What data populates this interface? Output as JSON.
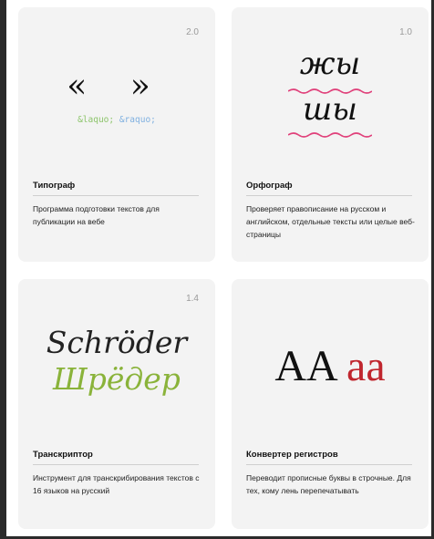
{
  "cards": [
    {
      "version": "2.0",
      "title": "Типограф",
      "description": "Программа подготовки текстов для публикации на вебе",
      "illustration": {
        "quotes": "« »",
        "entity_open": "&laquo;",
        "entity_close": "&raquo;"
      }
    },
    {
      "version": "1.0",
      "title": "Орфограф",
      "description": "Проверяет правописание на русском и английском, отдельные тексты или целые веб-страницы",
      "illustration": {
        "word1": "жы",
        "word2": "шы",
        "underline_color": "#e0407a"
      }
    },
    {
      "version": "1.4",
      "title": "Транскриптор",
      "description": "Инструмент для транскрибирования текстов с 16 языков на русский",
      "illustration": {
        "source": "Schröder",
        "target": "Шрёдер",
        "target_color": "#8ab33a"
      }
    },
    {
      "version": "",
      "title": "Конвертер регистров",
      "description": "Переводит прописные буквы в строчные. Для тех, кому лень перепечатывать",
      "illustration": {
        "upper": "AA",
        "lower": "aa",
        "lower_color": "#c0262e"
      }
    }
  ]
}
